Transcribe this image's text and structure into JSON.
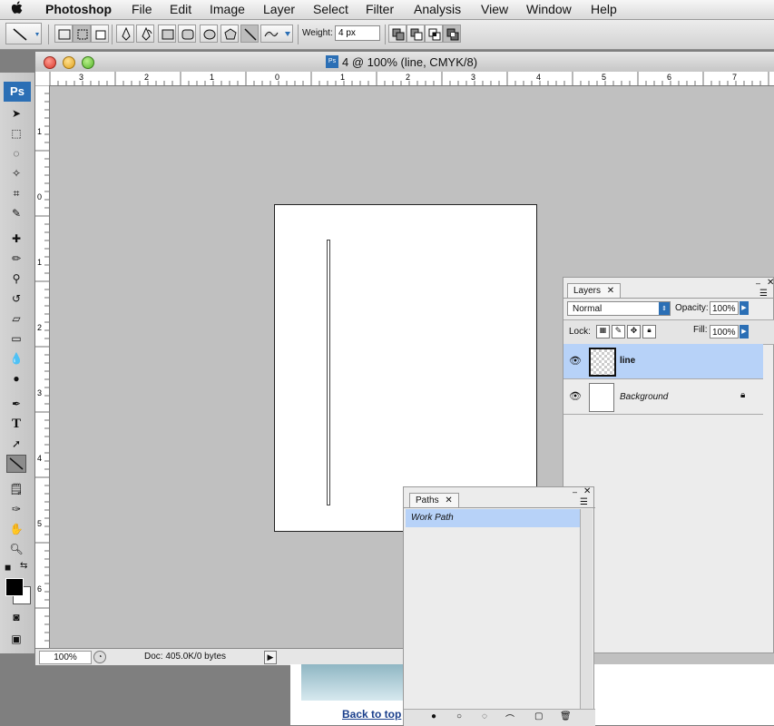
{
  "menubar": {
    "apple": "",
    "app": "Photoshop",
    "items": [
      "File",
      "Edit",
      "Image",
      "Layer",
      "Select",
      "Filter",
      "Analysis",
      "View",
      "Window",
      "Help"
    ]
  },
  "options": {
    "weight_label": "Weight:",
    "weight_value": "4 px"
  },
  "toolbox": {
    "logo": "Ps"
  },
  "document": {
    "title": "4 @ 100% (line, CMYK/8)",
    "ps_icon": "Ps",
    "hruler_labels": [
      "3",
      "2",
      "1",
      "0",
      "1",
      "2",
      "3",
      "4",
      "5",
      "6",
      "7"
    ],
    "vruler_labels": [
      "1",
      "0",
      "1",
      "2",
      "3",
      "4",
      "5",
      "6"
    ],
    "zoom": "100%",
    "doc_info": "Doc: 405.0K/0 bytes"
  },
  "layers_panel": {
    "tab": "Layers",
    "blend_mode": "Normal",
    "opacity_label": "Opacity:",
    "opacity": "100%",
    "lock_label": "Lock:",
    "fill_label": "Fill:",
    "fill": "100%",
    "layers": [
      {
        "name": "line",
        "selected": true
      },
      {
        "name": "Background",
        "selected": false
      }
    ]
  },
  "paths_panel": {
    "tab": "Paths",
    "items": [
      "Work Path"
    ]
  },
  "behind_page": {
    "link": "Back to top"
  },
  "colors": {
    "selection": "#b7d2f8",
    "accent": "#2b6fb5"
  }
}
